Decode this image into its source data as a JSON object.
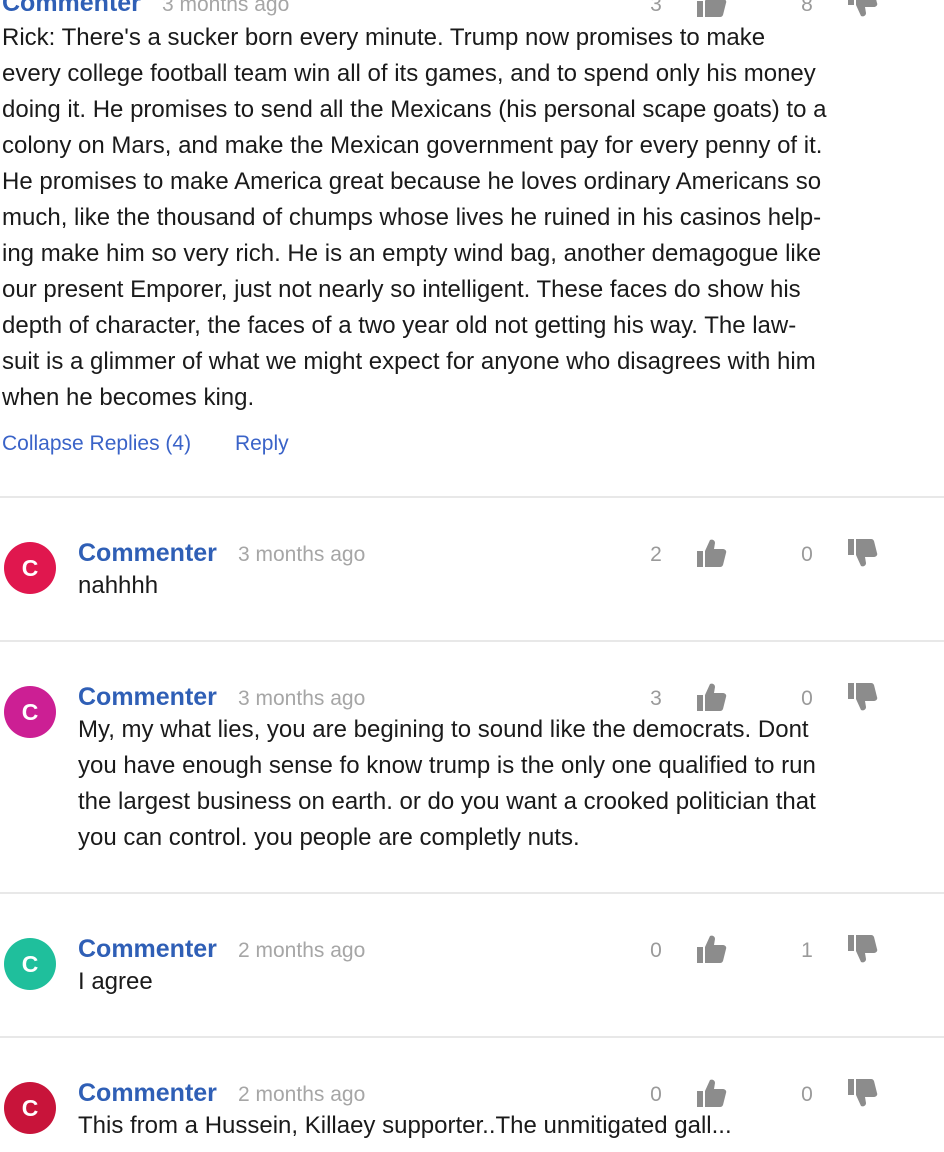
{
  "icons": {
    "upvote": "thumbs-up-icon",
    "downvote": "thumbs-down-icon"
  },
  "colors": {
    "author": "#2f5fb6",
    "link": "#3a63c8",
    "muted": "#a6a6a6",
    "icon": "#8c8c8c"
  },
  "main_comment": {
    "author": "Commenter",
    "time": "3 months ago",
    "upvotes": "3",
    "downvotes": "8",
    "text": "Rick: There's a sucker born every minute. Trump now promises to make\nevery college football team win all of its games, and to spend only his money\ndoing it. He promises to send all the Mexicans (his personal scape goats) to a\ncolony on Mars, and make the Mexican government pay for every penny of it.\nHe promises to make America great because he loves ordinary Americans so\nmuch, like the thousand of chumps whose lives he ruined in his casinos help-\ning make him so very rich. He is an empty wind bag, another demagogue like\nour present Emporer, just not nearly so intelligent. These faces do show his\ndepth of character, the faces of a two year old not getting his way. The law-\nsuit is a glimmer of what we might expect for anyone who disagrees with him\nwhen he becomes king.",
    "collapse_label": "Collapse Replies (4)",
    "reply_label": "Reply"
  },
  "replies": [
    {
      "avatar_letter": "C",
      "avatar_color": "#e0174e",
      "author": "Commenter",
      "time": "3 months ago",
      "upvotes": "2",
      "downvotes": "0",
      "text": "nahhhh"
    },
    {
      "avatar_letter": "C",
      "avatar_color": "#cc1f94",
      "author": "Commenter",
      "time": "3 months ago",
      "upvotes": "3",
      "downvotes": "0",
      "text": "My, my what lies, you are begining to sound like the democrats. Dont\nyou have enough sense fo know trump is the only one qualified to run\nthe largest business on earth. or do you want a crooked politician that\nyou can control. you people are completly nuts."
    },
    {
      "avatar_letter": "C",
      "avatar_color": "#1fbf9c",
      "author": "Commenter",
      "time": "2 months ago",
      "upvotes": "0",
      "downvotes": "1",
      "text": "I agree"
    },
    {
      "avatar_letter": "C",
      "avatar_color": "#c8143a",
      "author": "Commenter",
      "time": "2 months ago",
      "upvotes": "0",
      "downvotes": "0",
      "text": "This from a Hussein, Killaey supporter..The unmitigated gall..."
    }
  ]
}
